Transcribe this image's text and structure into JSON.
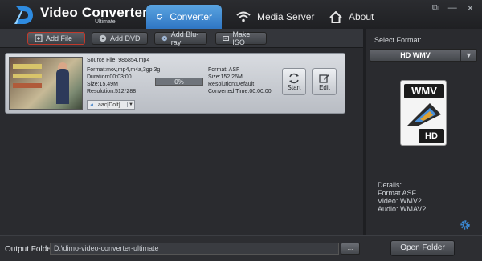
{
  "app": {
    "title": "Video Converter",
    "subtitle": "Ultimate"
  },
  "tabs": [
    {
      "label": "Converter",
      "active": true,
      "icon": "refresh-icon"
    },
    {
      "label": "Media Server",
      "active": false,
      "icon": "wifi-icon"
    },
    {
      "label": "About",
      "active": false,
      "icon": "home-icon"
    }
  ],
  "window_buttons": [
    "external-link-icon",
    "minimize-icon",
    "close-icon"
  ],
  "toolbar": {
    "add_file": "Add File",
    "add_dvd": "Add DVD",
    "add_bluray": "Add Blu-ray",
    "make_iso": "Make ISO"
  },
  "file": {
    "source": "Source File: 986854.mp4",
    "format_in": "Format:mov,mp4,m4a,3gp,3g",
    "duration": "Duration:00:03:00",
    "size_in": "Size:15.49M",
    "resolution_in": "Resolution:512*288",
    "progress": "0%",
    "progress_value": 0,
    "format_out": "Format: ASF",
    "size_out": "Size:152.26M",
    "resolution_out": "Resolution:Default",
    "converted_time": "Converted Time:00:00:00",
    "audio_track": "aac[Dolt]",
    "start_label": "Start",
    "edit_label": "Edit"
  },
  "right": {
    "select_format_label": "Select Format:",
    "format_value": "HD WMV",
    "icon_top": "WMV",
    "icon_bottom": "HD",
    "details_title": "Details:",
    "details_format": "Format ASF",
    "details_video": "Video: WMV2",
    "details_audio": "Audio: WMAV2"
  },
  "bottom": {
    "output_label": "Output Folder",
    "output_path": "D:\\dimo-video-converter-ultimate",
    "browse": "...",
    "open_folder": "Open Folder"
  },
  "colors": {
    "accent": "#3b8ad6",
    "highlight": "#c0392b"
  }
}
